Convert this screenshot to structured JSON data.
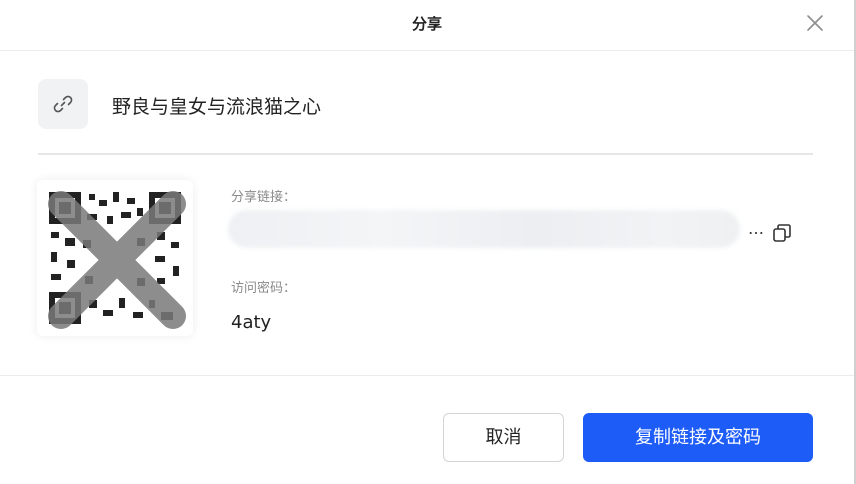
{
  "dialog": {
    "title": "分享"
  },
  "file": {
    "name": "野良与皇女与流浪猫之心"
  },
  "share": {
    "link_label": "分享链接：",
    "link_ellipsis": "…",
    "password_label": "访问密码：",
    "password_value": "4aty"
  },
  "buttons": {
    "cancel": "取消",
    "copy": "复制链接及密码"
  },
  "colors": {
    "primary": "#1d5cf6",
    "divider": "#e6e6e6",
    "icon_bg": "#f1f2f4"
  },
  "icons": {
    "close": "close-icon",
    "file": "link-icon",
    "copy": "copy-icon",
    "qr": "qr-code-redacted"
  }
}
